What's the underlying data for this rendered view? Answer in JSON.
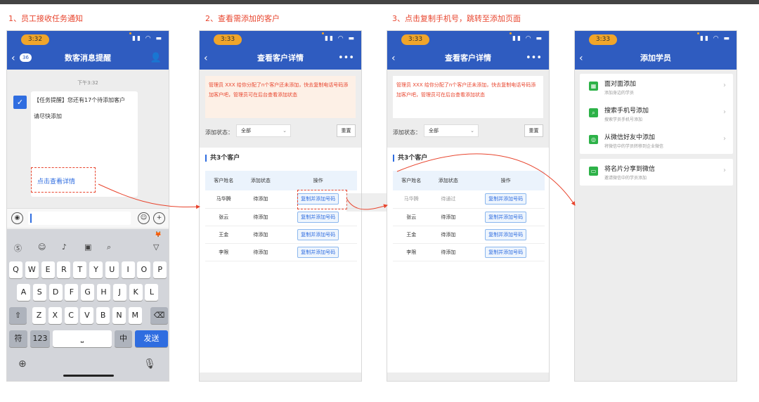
{
  "steps": [
    {
      "title": "1、员工接收任务通知"
    },
    {
      "title": "2、查看需添加的客户"
    },
    {
      "title": "3、点击复制手机号，跳转至添加页面"
    }
  ],
  "status_time": "3:32",
  "status_time_2": "3:33",
  "phone1": {
    "nav_badge": "36",
    "nav_title": "数客消息提醒",
    "time_label": "下午3:32",
    "message_line1": "【任务提醒】您还有17个待添加客户",
    "message_line2": "请尽快添加",
    "link_text": "点击查看详情",
    "keys_row1": [
      "Q",
      "W",
      "E",
      "R",
      "T",
      "Y",
      "U",
      "I",
      "O",
      "P"
    ],
    "keys_row2": [
      "A",
      "S",
      "D",
      "F",
      "G",
      "H",
      "J",
      "K",
      "L"
    ],
    "keys_row3": [
      "Z",
      "X",
      "C",
      "V",
      "B",
      "N",
      "M"
    ],
    "key_fu": "符",
    "key_123": "123",
    "key_zhong": "中",
    "key_send": "发送"
  },
  "detail": {
    "nav_title": "查看客户详情",
    "notice": "管理员 XXX 给你分配了n个客户还未添加，快去复制电话号码添加客户吧，管理员可在后台查看添加状态",
    "filter_label": "添加状态：",
    "filter_value": "全部",
    "reset": "重置",
    "list_title": "共3个客户",
    "headers": [
      "客户姓名",
      "添加状态",
      "操作"
    ],
    "copy_label": "复制并添加号码",
    "rows_phone2": [
      {
        "name": "马华腾",
        "status": "待添加"
      },
      {
        "name": "张云",
        "status": "待添加"
      },
      {
        "name": "王金",
        "status": "待添加"
      },
      {
        "name": "李限",
        "status": "待添加"
      }
    ],
    "rows_phone3": [
      {
        "name": "马华腾",
        "status": "待通过"
      },
      {
        "name": "张云",
        "status": "待添加"
      },
      {
        "name": "王金",
        "status": "待添加"
      },
      {
        "name": "李限",
        "status": "待添加"
      }
    ]
  },
  "phone4": {
    "nav_title": "添加学员",
    "items": [
      {
        "label": "面对面添加",
        "sub": "添加身边的学员"
      },
      {
        "label": "搜索手机号添加",
        "sub": "搜索学员手机号添加"
      },
      {
        "label": "从微信好友中添加",
        "sub": "将微信中的学员转移到企业微信"
      },
      {
        "label": "将名片分享到微信",
        "sub": "邀请微信中的学员添加"
      }
    ]
  }
}
